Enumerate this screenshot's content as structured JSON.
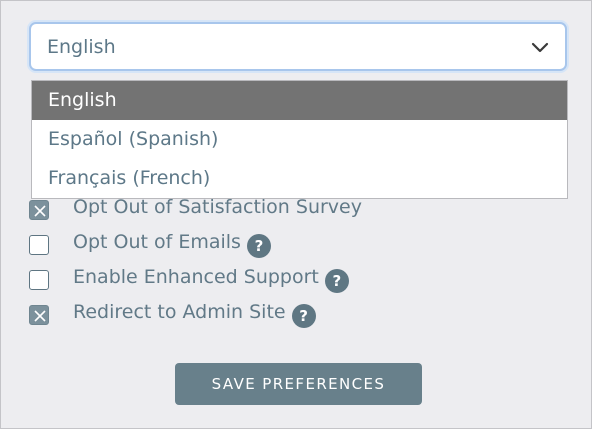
{
  "language_select": {
    "value": "English",
    "options": [
      "English",
      "Español (Spanish)",
      "Français (French)"
    ],
    "selected_index": 0
  },
  "preferences": [
    {
      "label": "Opt Out of Satisfaction Survey",
      "checked": true,
      "has_help": false
    },
    {
      "label": "Opt Out of Emails",
      "checked": false,
      "has_help": true
    },
    {
      "label": "Enable Enhanced Support",
      "checked": false,
      "has_help": true
    },
    {
      "label": "Redirect to Admin Site",
      "checked": true,
      "has_help": true
    }
  ],
  "help_icon_glyph": "?",
  "save_button": {
    "label": "SAVE PREFERENCES"
  },
  "colors": {
    "panel_bg": "#ededf0",
    "accent": "#68808b",
    "text": "#617987",
    "selected_option_bg": "#737373"
  }
}
